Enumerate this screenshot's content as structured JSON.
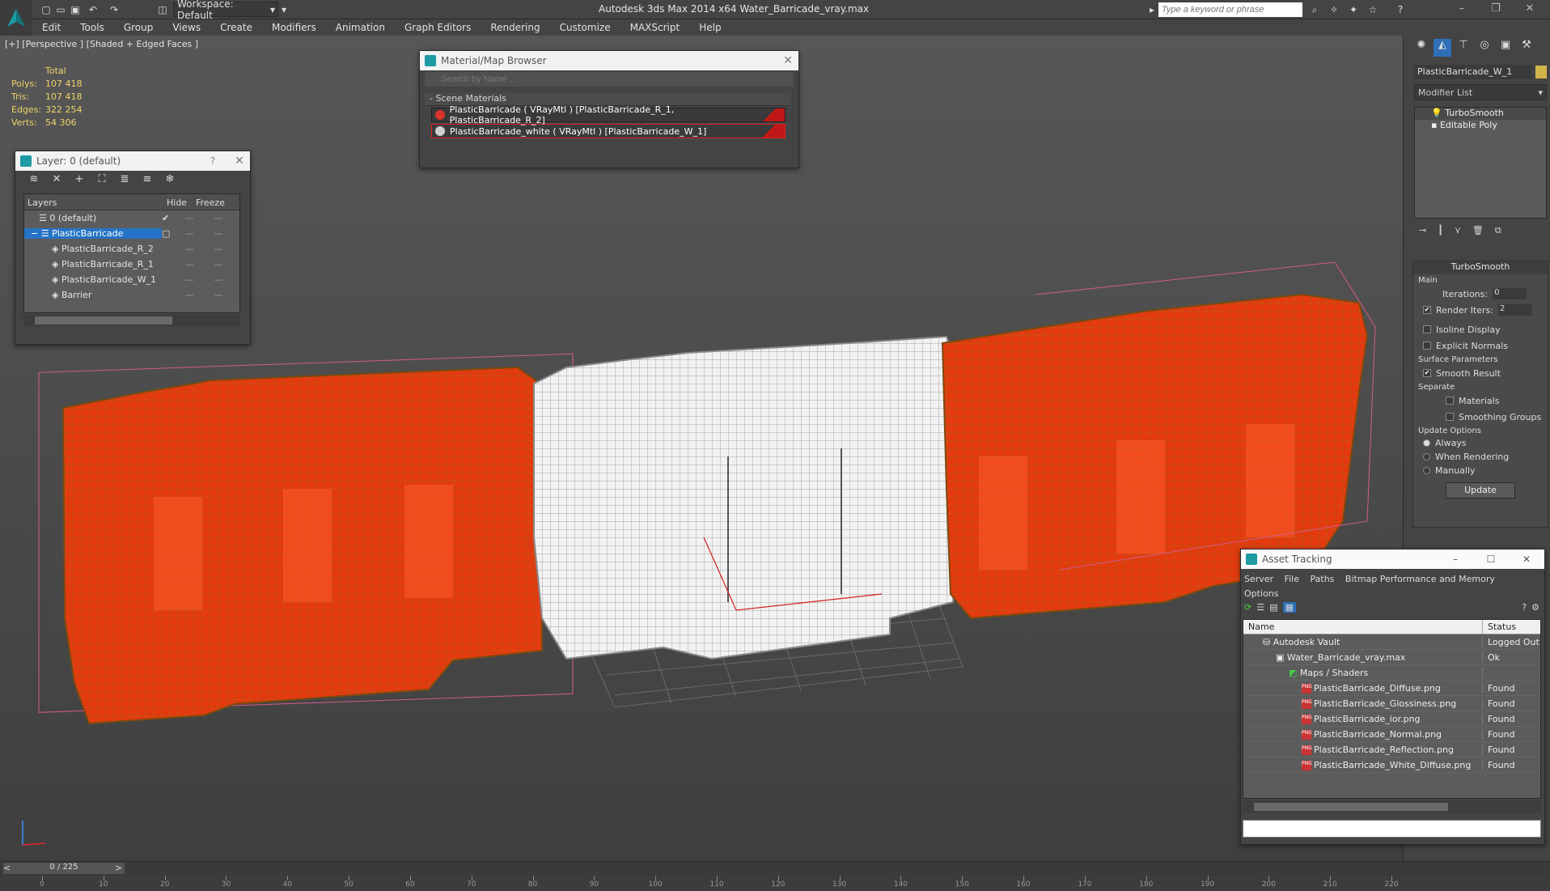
{
  "app": {
    "title": "Autodesk 3ds Max  2014 x64    Water_Barricade_vray.max",
    "workspace": "Workspace: Default",
    "search_placeholder": "Type a keyword or phrase"
  },
  "menu": [
    "Edit",
    "Tools",
    "Group",
    "Views",
    "Create",
    "Modifiers",
    "Animation",
    "Graph Editors",
    "Rendering",
    "Customize",
    "MAXScript",
    "Help"
  ],
  "viewport": {
    "label": "[+] [Perspective ] [Shaded + Edged Faces ]",
    "stats": {
      "header": "Total",
      "rows": [
        {
          "label": "Polys:",
          "value": "107 418"
        },
        {
          "label": "Tris:",
          "value": "107 418"
        },
        {
          "label": "Edges:",
          "value": "322 254"
        },
        {
          "label": "Verts:",
          "value": "54 306"
        }
      ]
    }
  },
  "layer_window": {
    "title": "Layer: 0 (default)",
    "help": "?",
    "columns": [
      "Layers",
      "Hide",
      "Freeze"
    ],
    "rows": [
      {
        "name": "0 (default)",
        "indent": 1
      },
      {
        "name": "PlasticBarricade",
        "indent": 1
      },
      {
        "name": "PlasticBarricade_R_2",
        "indent": 2
      },
      {
        "name": "PlasticBarricade_R_1",
        "indent": 2
      },
      {
        "name": "PlasticBarricade_W_1",
        "indent": 2
      },
      {
        "name": "Barrier",
        "indent": 2
      }
    ],
    "selected": "PlasticBarricade"
  },
  "material_browser": {
    "title": "Material/Map Browser",
    "search_placeholder": "Search by Name ...",
    "section": "- Scene Materials",
    "materials": [
      {
        "label": "PlasticBarricade  ( VRayMtl ) [PlasticBarricade_R_1, PlasticBarricade_R_2]",
        "color": "#d9332a"
      },
      {
        "label": "PlasticBarricade_white  ( VRayMtl ) [PlasticBarricade_W_1]",
        "color": "#cfcfcf"
      }
    ]
  },
  "command_panel": {
    "object_name": "PlasticBarricade_W_1",
    "modifier_list": "Modifier List",
    "stack": [
      "TurboSmooth",
      "Editable Poly"
    ],
    "turbosmooth": {
      "title": "TurboSmooth",
      "main_label": "Main",
      "iterations_label": "Iterations:",
      "iterations": "0",
      "render_iters_label": "Render Iters:",
      "render_iters": "2",
      "isoline": "Isoline Display",
      "explicit_normals": "Explicit Normals",
      "surface_params": "Surface Parameters",
      "smooth_result": "Smooth Result",
      "separate": "Separate",
      "materials": "Materials",
      "smoothing_groups": "Smoothing Groups",
      "update_options": "Update Options",
      "always": "Always",
      "when_rendering": "When Rendering",
      "manually": "Manually",
      "update_btn": "Update"
    }
  },
  "asset_tracking": {
    "title": "Asset Tracking",
    "menu": [
      "Server",
      "File",
      "Paths",
      "Bitmap Performance and Memory",
      "Options"
    ],
    "columns": [
      "Name",
      "Status"
    ],
    "rows": [
      {
        "name": "Autodesk Vault",
        "status": "Logged Out",
        "indent": 0
      },
      {
        "name": "Water_Barricade_vray.max",
        "status": "Ok",
        "indent": 1
      },
      {
        "name": "Maps / Shaders",
        "status": "",
        "indent": 2
      },
      {
        "name": "PlasticBarricade_Diffuse.png",
        "status": "Found",
        "indent": 3
      },
      {
        "name": "PlasticBarricade_Glossiness.png",
        "status": "Found",
        "indent": 3
      },
      {
        "name": "PlasticBarricade_ior.png",
        "status": "Found",
        "indent": 3
      },
      {
        "name": "PlasticBarricade_Normal.png",
        "status": "Found",
        "indent": 3
      },
      {
        "name": "PlasticBarricade_Reflection.png",
        "status": "Found",
        "indent": 3
      },
      {
        "name": "PlasticBarricade_White_Diffuse.png",
        "status": "Found",
        "indent": 3
      }
    ]
  },
  "timeline": {
    "frame": "0 / 225",
    "ticks": [
      "0",
      "10",
      "20",
      "30",
      "40",
      "50",
      "60",
      "70",
      "80",
      "90",
      "100",
      "110",
      "120",
      "130",
      "140",
      "150",
      "160",
      "170",
      "180",
      "190",
      "200",
      "210",
      "220"
    ]
  }
}
